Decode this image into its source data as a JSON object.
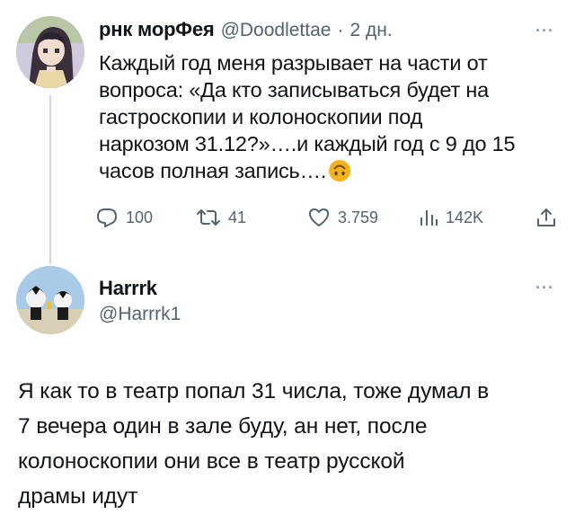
{
  "tweet1": {
    "author_name": "рнк морФея",
    "handle": "@Doodlettae",
    "separator": "·",
    "time": "2 дн.",
    "more": "···",
    "text_lines": [
      "Каждый год меня разрывает на части от",
      "вопроса: «Да кто записываться будет на",
      "гастроскопии и колоноскопии под",
      "наркозом 31.12?»….и каждый год с 9 до 15",
      "часов полная запись…."
    ],
    "emoji": "upside-down-face",
    "actions": {
      "replies": "100",
      "retweets": "41",
      "likes": "3.759",
      "views": "142K"
    }
  },
  "tweet2": {
    "author_name": "Harrrk",
    "handle": "@Harrrk1",
    "more": "···",
    "text_lines": [
      "Я как то в театр попал 31 числа, тоже думал в",
      "7 вечера один в зале буду, ан нет, после",
      "колоноскопии они все в театр русской",
      "драмы идут"
    ]
  },
  "colors": {
    "text": "#0f1419",
    "secondary": "#536471",
    "thread_line": "#cfd9de",
    "emoji": "#f7b21b"
  }
}
